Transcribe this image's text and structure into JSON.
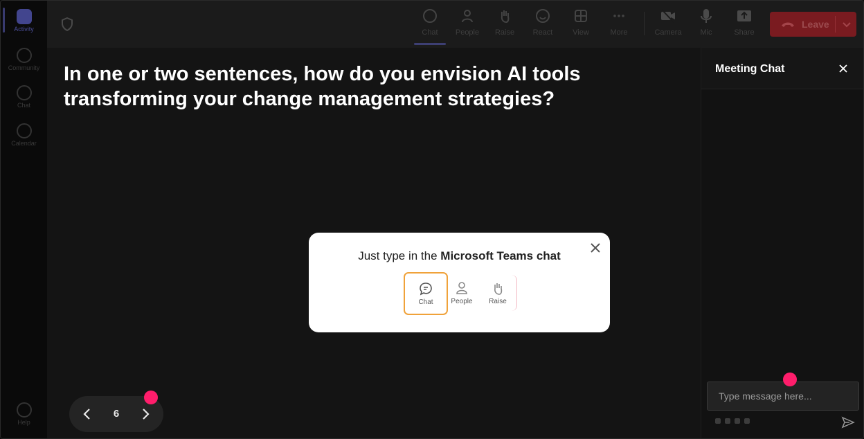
{
  "rail": {
    "items": [
      {
        "label": "Activity",
        "icon": "bell-icon"
      },
      {
        "label": "Community",
        "icon": "community-icon"
      },
      {
        "label": "Chat",
        "icon": "chat-icon"
      },
      {
        "label": "Calendar",
        "icon": "calendar-icon"
      },
      {
        "label": "Help",
        "icon": "help-icon"
      }
    ]
  },
  "toolbar": {
    "buttons": [
      {
        "label": "Chat",
        "icon": "chat-bubble-icon"
      },
      {
        "label": "People",
        "icon": "person-icon"
      },
      {
        "label": "Raise",
        "icon": "hand-icon"
      },
      {
        "label": "React",
        "icon": "smiley-icon"
      },
      {
        "label": "View",
        "icon": "grid-icon"
      },
      {
        "label": "More",
        "icon": "more-dots-icon"
      },
      {
        "label": "Camera",
        "icon": "camera-off-icon"
      },
      {
        "label": "Mic",
        "icon": "mic-icon"
      },
      {
        "label": "Share",
        "icon": "share-icon"
      }
    ],
    "leave_label": "Leave",
    "leave_color": "#c4262e"
  },
  "main": {
    "question": "In one or two sentences, how do you envision AI tools transforming your change management strategies?"
  },
  "popup": {
    "text_prefix": "Just type in the ",
    "text_bold": "Microsoft Teams chat",
    "items": [
      {
        "label": "Chat",
        "icon": "chat-bubble-icon"
      },
      {
        "label": "People",
        "icon": "person-icon"
      },
      {
        "label": "Raise",
        "icon": "hand-icon"
      }
    ],
    "highlight_color": "#f0a23a"
  },
  "slide_nav": {
    "current": "6"
  },
  "chat_panel": {
    "title": "Meeting Chat",
    "input_placeholder": "Type message here..."
  },
  "accent": "#ff1d6b"
}
